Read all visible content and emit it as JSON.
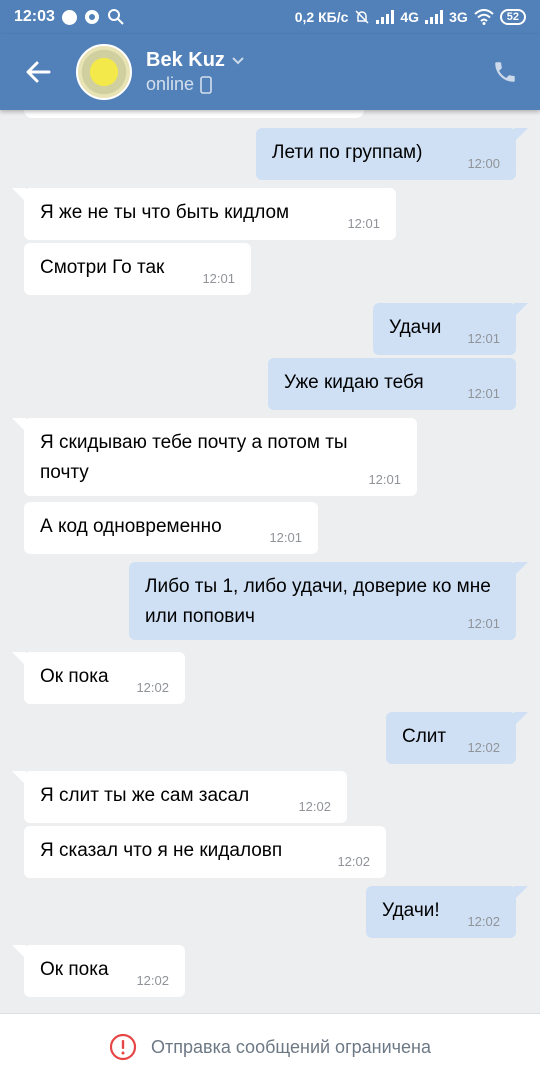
{
  "status_bar": {
    "time": "12:03",
    "speed": "0,2 КБ/с",
    "net1": "4G",
    "net2": "3G",
    "battery": "52"
  },
  "header": {
    "name": "Bek Kuz",
    "status": "online"
  },
  "messages": [
    {
      "dir": "out",
      "text": "Лети по группам)",
      "time": "12:00"
    },
    {
      "dir": "in",
      "text": "Я же не ты что быть кидлом",
      "time": "12:01"
    },
    {
      "dir": "in",
      "text": "Смотри Го так",
      "time": "12:01"
    },
    {
      "dir": "out",
      "text": "Удачи",
      "time": "12:01"
    },
    {
      "dir": "out",
      "text": "Уже кидаю тебя",
      "time": "12:01"
    },
    {
      "dir": "in",
      "text": "Я скидываю тебе почту а потом ты почту",
      "time": "12:01"
    },
    {
      "dir": "in",
      "text": "А код одновременно",
      "time": "12:01"
    },
    {
      "dir": "out",
      "text": "Либо ты 1, либо удачи, доверие ко мне или попович",
      "time": "12:01"
    },
    {
      "dir": "in",
      "text": "Ок пока",
      "time": "12:02"
    },
    {
      "dir": "out",
      "text": "Слит",
      "time": "12:02"
    },
    {
      "dir": "in",
      "text": "Я слит ты же сам засал",
      "time": "12:02"
    },
    {
      "dir": "in",
      "text": "Я сказал что я не кидаловп",
      "time": "12:02"
    },
    {
      "dir": "out",
      "text": "Удачи!",
      "time": "12:02"
    },
    {
      "dir": "in",
      "text": "Ок пока",
      "time": "12:02"
    }
  ],
  "footer": {
    "notice": "Отправка сообщений ограничена"
  },
  "icons": {
    "back": "arrow-left-icon",
    "call": "phone-icon",
    "warning": "alert-circle-icon",
    "chevron": "chevron-down-icon",
    "mobile": "mobile-icon"
  },
  "colors": {
    "header": "#5181b8",
    "incoming": "#ffffff",
    "outgoing": "#cfe0f5",
    "background": "#edeef0",
    "warning": "#e64646"
  }
}
